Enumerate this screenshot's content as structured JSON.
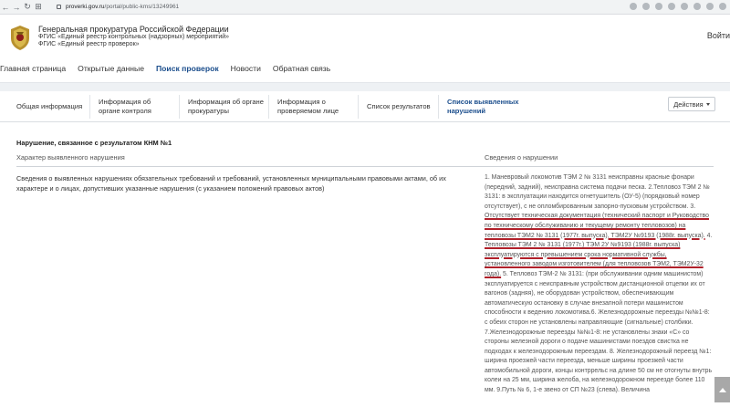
{
  "browser": {
    "url_host": "proverki.gov.ru",
    "url_path": "/portal/public-kms/13249961"
  },
  "header": {
    "org_title": "Генеральная прокуратура Российской Федерации",
    "sub1": "ФГИС «Единый реестр контрольных (надзорных) мероприятий»",
    "sub2": "ФГИС «Единый реестр проверок»",
    "login": "Войти"
  },
  "nav": {
    "items": [
      "Главная страница",
      "Открытые данные",
      "Поиск проверок",
      "Новости",
      "Обратная связь"
    ],
    "active": "Поиск проверок"
  },
  "tabs": [
    "Общая информация",
    "Информация об органе контроля",
    "Информация об органе прокуратуры",
    "Информация о проверяемом лице",
    "Список результатов",
    "Список выявленных нарушений"
  ],
  "actions_label": "Действия",
  "content": {
    "section_title": "Нарушение, связанное с результатом КНМ №1",
    "col_left": "Характер выявленного нарушения",
    "col_right": "Сведения о нарушении",
    "left_text": "Сведения о выявленных нарушениях обязательных требований и требований, установленных муниципальными правовыми актами, об их характере и о лицах, допустивших указанные нарушения (с указанием положений правовых актов)",
    "right_p1": "1. Маневровый локомотив ТЭМ 2 № 3131 неисправны красные фонари (передний, задний), неисправна система подачи песка. 2.Тепловоз ТЭМ 2 № 3131: в эксплуатации находится огнетушитель (ОУ-5) (порядковый номер отсутствует), с не опломбированным запорно-пусковым устройством. 3. ",
    "right_u1": "Отсутствует техническая документация (технический паспорт и Руководство по техническому обслуживанию и текущему ремонту тепловозов) на тепловозы ТЭМ2 № 3131 (1977г. выпуска), ТЭМ2У №9193 (1988г. выпуска).",
    "right_mid": "4. ",
    "right_u2": "Тепловозы ТЭМ 2 № 3131 (1977г.) ТЭМ 2У №9193 (1988г. выпуска) эксплуатируются с превышением срока нормативной службы, установленного заводом изготовителем (для тепловозов ТЭМ2, ТЭМ2У-32 года).",
    "right_p2": " 5. Тепловоз ТЭМ-2 № 3131: (при обслуживании одним машинистом) эксплуатируется с неисправным устройством дистанционной отцепки их от вагонов (задняя), не оборудован устройством, обеспечивающим автоматическую остановку в случае внезапной потери машинистом способности к ведению локомотива.6. Железнодорожные переезды №№1-8: с обеих сторон не установлены направляющие (сигнальные) столбики. 7.Железнодорожные переезды №№1-8: не установлены знаки «С» со стороны железной дороги о подаче машинистами поездов свистка не подходах к железнодорожным переездам. 8. Железнодорожный переезд №1: ширина проезжей части переезда, меньше ширины проезжей части автомобильной дороги, концы контррельс на длине 50 см не отогнуты внутрь колеи на 25 мм, ширина желоба, на железнодорожном переезде более 110 мм. 9.Путь № 6, 1-е звено от СП №23 (слева). Величина"
  },
  "colors": {
    "accent": "#1a4d8c",
    "underline": "#b0202a"
  }
}
